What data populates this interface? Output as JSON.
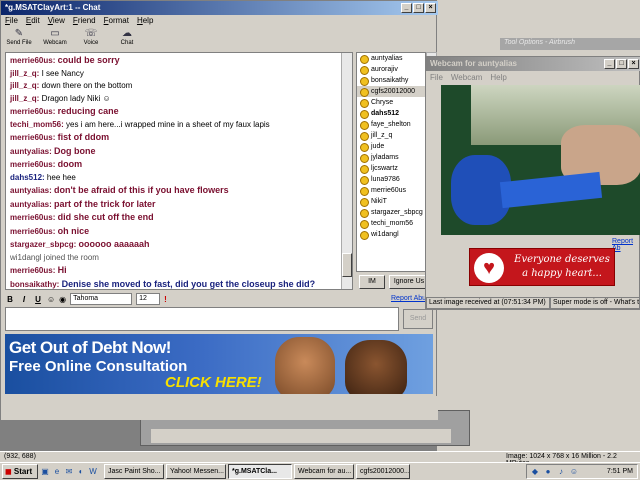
{
  "background": {
    "tool_options_title": "Tool Options - Airbrush",
    "status_coords": "(932, 688)",
    "status_image": "Image: 1024 x 768 x 16 Million - 2.2 MBytes"
  },
  "chat_window": {
    "title": "*g.MSATClayArt:1 -- Chat",
    "menu": [
      "File",
      "Edit",
      "View",
      "Friend",
      "Format",
      "Help"
    ],
    "toolbar": [
      {
        "label": "Send File",
        "icon": "send-file-icon"
      },
      {
        "label": "Webcam",
        "icon": "webcam-icon"
      },
      {
        "label": "Voice",
        "icon": "voice-icon"
      },
      {
        "label": "Chat",
        "icon": "chat-icon"
      }
    ],
    "messages": [
      {
        "user": "merrie60us:",
        "text": "could be sorry",
        "style": "big"
      },
      {
        "user": "jill_z_q:",
        "text": "I see Nancy",
        "style": "normal"
      },
      {
        "user": "jill_z_q:",
        "text": "down there on the bottom",
        "style": "normal"
      },
      {
        "user": "jill_z_q:",
        "text": "Dragon lady Niki",
        "style": "normal",
        "emoji": true
      },
      {
        "user": "merrie60us:",
        "text": "reducing cane",
        "style": "big"
      },
      {
        "user": "techi_mom56:",
        "text": "yes i am here...i wrapped mine in a sheet of my faux lapis",
        "style": "normal"
      },
      {
        "user": "merrie60us:",
        "text": "fist of ddom",
        "style": "big"
      },
      {
        "user": "auntyalias:",
        "text": "Dog bone",
        "style": "big"
      },
      {
        "user": "merrie60us:",
        "text": "doom",
        "style": "big"
      },
      {
        "user": "dahs512:",
        "text": "hee hee",
        "style": "normal",
        "blue": true
      },
      {
        "user": "auntyalias:",
        "text": "don't be afraid of this if you have flowers",
        "style": "big"
      },
      {
        "user": "auntyalias:",
        "text": "part of the trick for later",
        "style": "big"
      },
      {
        "user": "merrie60us:",
        "text": "did she cut off the end",
        "style": "big"
      },
      {
        "user": "merrie60us:",
        "text": "oh nice",
        "style": "big"
      },
      {
        "user": "stargazer_sbpcg:",
        "text": "oooooo aaaaaah",
        "style": "big"
      },
      {
        "user": "",
        "text": "wi1dangl joined the room",
        "style": "sys"
      },
      {
        "user": "merrie60us:",
        "text": "Hi",
        "style": "big"
      },
      {
        "user": "bonsaikathy:",
        "text": "Denise she moved to fast, did you get the closeup she did?",
        "style": "bigblue"
      }
    ],
    "users": [
      {
        "name": "auntyalias",
        "bold": false,
        "selected": false
      },
      {
        "name": "aurorajiv",
        "bold": false,
        "selected": false
      },
      {
        "name": "bonsaikathy",
        "bold": false,
        "selected": false
      },
      {
        "name": "cgfs20012000",
        "bold": false,
        "selected": true
      },
      {
        "name": "Chryse",
        "bold": false,
        "selected": false
      },
      {
        "name": "dahs512",
        "bold": true,
        "selected": false
      },
      {
        "name": "faye_shelton",
        "bold": false,
        "selected": false
      },
      {
        "name": "jill_z_q",
        "bold": false,
        "selected": false
      },
      {
        "name": "jude",
        "bold": false,
        "selected": false
      },
      {
        "name": "jyladams",
        "bold": false,
        "selected": false
      },
      {
        "name": "ljcswartz",
        "bold": false,
        "selected": false
      },
      {
        "name": "luna9786",
        "bold": false,
        "selected": false
      },
      {
        "name": "merrie60us",
        "bold": false,
        "selected": false
      },
      {
        "name": "NikiT",
        "bold": false,
        "selected": false
      },
      {
        "name": "stargazer_sbpcg",
        "bold": false,
        "selected": false
      },
      {
        "name": "techi_mom56",
        "bold": false,
        "selected": false
      },
      {
        "name": "wi1dangl",
        "bold": false,
        "selected": false
      }
    ],
    "im_button": "IM",
    "ignore_button": "Ignore Us",
    "format": {
      "font": "Tahoma",
      "size": "12",
      "bold": "B",
      "italic": "I",
      "underline": "U"
    },
    "report_link": "Report Abuse",
    "send_button": "Send",
    "ad": {
      "line1": "Get Out of Debt Now!",
      "line2": "Free Online Consultation",
      "cta": "CLICK HERE!"
    }
  },
  "webcam_window": {
    "title": "Webcam for auntyalias",
    "menu": [
      "File",
      "Webcam",
      "Help"
    ],
    "report_link": "Report Ab",
    "ad_text": "Everyone deserves a happy heart...",
    "status_last_image": "Last image received at (07:51:34 PM)",
    "status_super": "Super mode is off - What's t"
  },
  "taskbar": {
    "start": "Start",
    "tasks": [
      {
        "label": "Jasc Paint Sho...",
        "active": false
      },
      {
        "label": "Yahoo! Messen...",
        "active": false
      },
      {
        "label": "*g.MSATCla...",
        "active": true
      },
      {
        "label": "Webcam for au...",
        "active": false
      },
      {
        "label": "cgfs20012000...",
        "active": false
      }
    ],
    "clock": "7:51 PM"
  }
}
